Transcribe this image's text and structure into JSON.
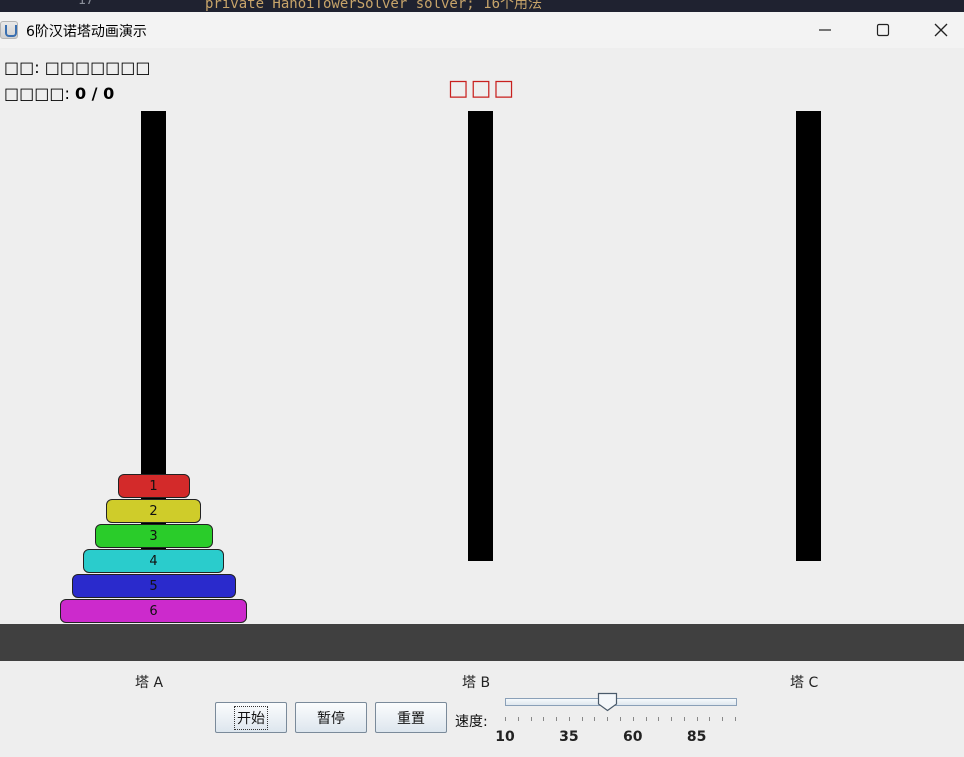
{
  "background": {
    "line_number": "17",
    "code_text": "private HanoiTowerSolver solver;  16个用法"
  },
  "window": {
    "title": "6阶汉诺塔动画演示",
    "controls": {
      "minimize": "minimize-icon",
      "maximize": "maximize-icon",
      "close": "close-icon"
    }
  },
  "status": {
    "state_label": "□□: □□□□□□□",
    "steps_label": "□□□□: ",
    "steps_value": "0 / 0",
    "center_message": "□□□",
    "center_message_color": "#c8201e"
  },
  "towers": [
    {
      "label": "塔 A"
    },
    {
      "label": "塔 B"
    },
    {
      "label": "塔 C"
    }
  ],
  "disks": [
    {
      "number": "1",
      "color": "#d32a2a",
      "tower": "A"
    },
    {
      "number": "2",
      "color": "#cfcc2a",
      "tower": "A"
    },
    {
      "number": "3",
      "color": "#2acc2a",
      "tower": "A"
    },
    {
      "number": "4",
      "color": "#2acccc",
      "tower": "A"
    },
    {
      "number": "5",
      "color": "#2a2acc",
      "tower": "A"
    },
    {
      "number": "6",
      "color": "#cc2acc",
      "tower": "A"
    }
  ],
  "controls": {
    "start_label": "开始",
    "pause_label": "暂停",
    "reset_label": "重置",
    "speed_label": "速度:",
    "speed": {
      "min": 10,
      "max": 100,
      "value": 50,
      "tick_labels": [
        "10",
        "35",
        "60",
        "85"
      ]
    }
  }
}
